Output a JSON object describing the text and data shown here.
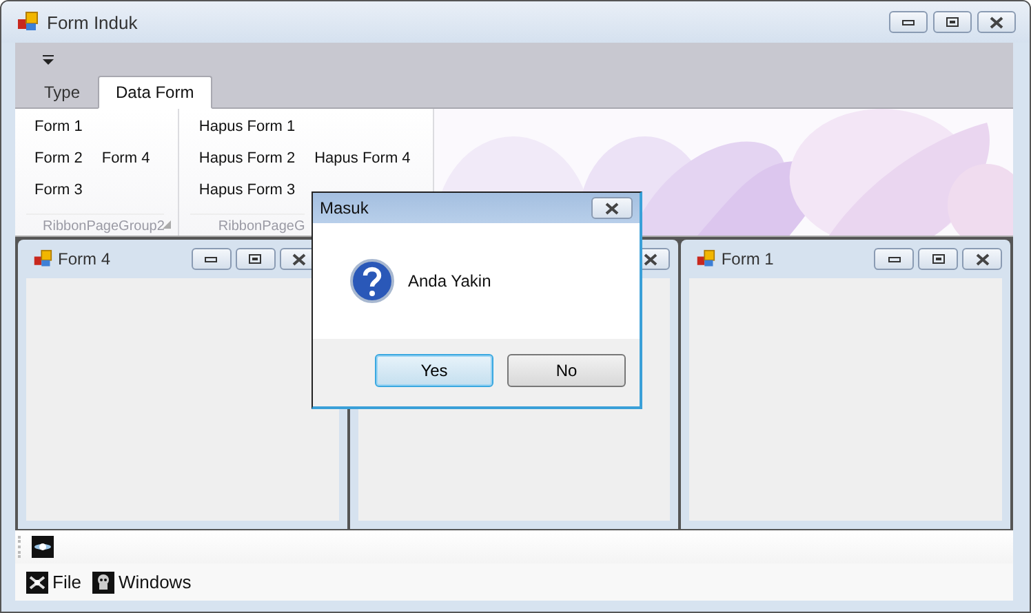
{
  "window": {
    "title": "Form Induk"
  },
  "ribbon": {
    "tabs": [
      {
        "label": "Type",
        "selected": false
      },
      {
        "label": "Data Form",
        "selected": true
      }
    ],
    "groups": [
      {
        "caption": "RibbonPageGroup2",
        "columns": [
          {
            "items": [
              "Form 1",
              "Form 2",
              "Form 3"
            ]
          },
          {
            "items": [
              "Form 4"
            ]
          }
        ]
      },
      {
        "caption": "RibbonPageG",
        "columns": [
          {
            "items": [
              "Hapus Form 1",
              "Hapus Form 2",
              "Hapus Form 3"
            ]
          },
          {
            "items": [
              "Hapus Form 4"
            ]
          }
        ]
      }
    ]
  },
  "mdi_children": [
    {
      "kind": "titled",
      "title": "Form 4"
    },
    {
      "kind": "covered"
    },
    {
      "kind": "titled",
      "title": "Form 1"
    }
  ],
  "dialog": {
    "title": "Masuk",
    "message": "Anda Yakin",
    "buttons": [
      {
        "label": "Yes",
        "selected": true
      },
      {
        "label": "No",
        "selected": false
      }
    ]
  },
  "menu": [
    {
      "label": "File",
      "kind": "file"
    },
    {
      "label": "Windows",
      "kind": "windows"
    }
  ]
}
